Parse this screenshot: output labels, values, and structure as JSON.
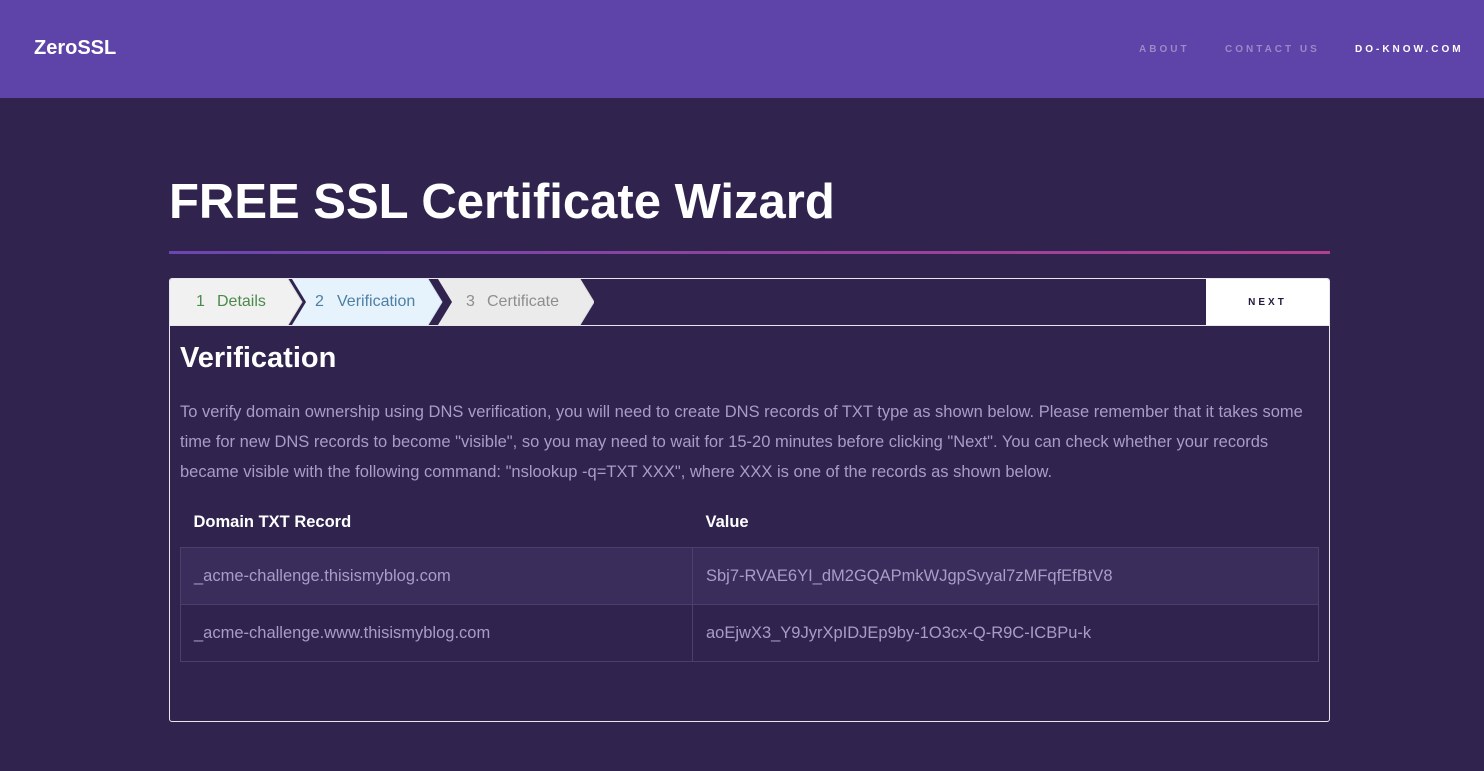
{
  "header": {
    "brand": "ZeroSSL",
    "nav": {
      "about": "ABOUT",
      "contact": "CONTACT US",
      "doknow": "DO-KNOW.COM"
    }
  },
  "page": {
    "title": "FREE SSL Certificate Wizard"
  },
  "wizard": {
    "steps": [
      {
        "number": "1",
        "label": "Details",
        "state": "completed"
      },
      {
        "number": "2",
        "label": "Verification",
        "state": "active"
      },
      {
        "number": "3",
        "label": "Certificate",
        "state": "pending"
      }
    ],
    "next_label": "NEXT"
  },
  "verification": {
    "title": "Verification",
    "instructions": "To verify domain ownership using DNS verification, you will need to create DNS records of TXT type as shown below. Please remember that it takes some time for new DNS records to become \"visible\", so you may need to wait for 15-20 minutes before clicking \"Next\". You can check whether your records became visible with the following command: \"nslookup -q=TXT XXX\", where XXX is one of the records as shown below.",
    "table": {
      "headers": [
        "Domain TXT Record",
        "Value"
      ],
      "rows": [
        [
          "_acme-challenge.thisismyblog.com",
          "Sbj7-RVAE6YI_dM2GQAPmkWJgpSvyal7zMFqfEfBtV8"
        ],
        [
          "_acme-challenge.www.thisismyblog.com",
          "aoEjwX3_Y9JyrXpIDJEp9by-1O3cx-Q-R9C-ICBPu-k"
        ]
      ]
    }
  },
  "colors": {
    "header_bg": "#5e43a8",
    "page_bg": "#30244f",
    "step_completed_text": "#4c8a4c",
    "step_active_text": "#4d7fa3",
    "step_pending_text": "#8e8e8e",
    "body_text": "#a99cc7"
  }
}
